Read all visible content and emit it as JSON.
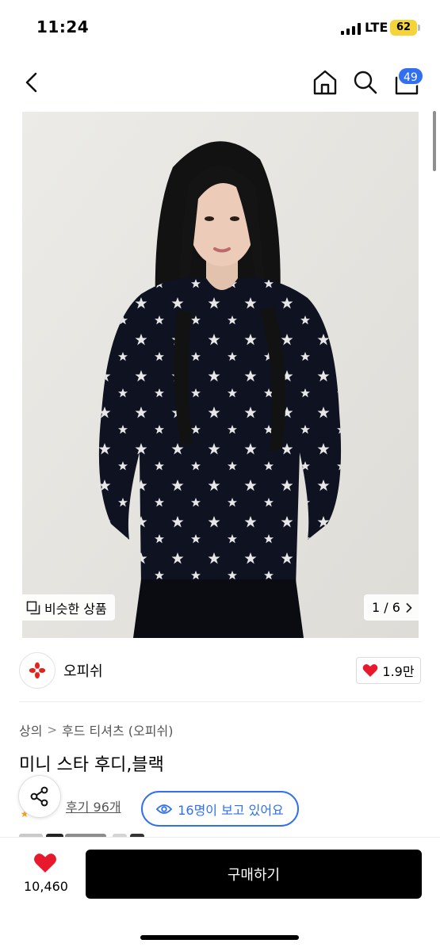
{
  "status_bar": {
    "time": "11:24",
    "network": "LTE",
    "battery": "62"
  },
  "nav": {
    "cart_count": "49"
  },
  "gallery": {
    "similar_label": "비슷한 상품",
    "page_counter": "1 / 6"
  },
  "brand": {
    "name": "오피쉬",
    "like_count": "1.9만"
  },
  "breadcrumb": {
    "items": [
      "상의",
      "후드 티셔츠 (오피쉬)"
    ]
  },
  "product": {
    "title": "미니 스타 후디,블랙",
    "review_link": "후기 96개",
    "viewers": "16명이 보고 있어요"
  },
  "bottom_bar": {
    "like_count": "10,460",
    "buy_label": "구매하기"
  },
  "colors": {
    "accent_blue": "#2f6ff0",
    "heart_red": "#e8192c",
    "battery_yellow": "#f5d33b"
  },
  "icons": [
    "back-icon",
    "home-icon",
    "search-icon",
    "cart-icon",
    "similar-icon",
    "chevron-right-icon",
    "brand-logo-icon",
    "heart-icon",
    "share-icon",
    "eye-icon"
  ]
}
